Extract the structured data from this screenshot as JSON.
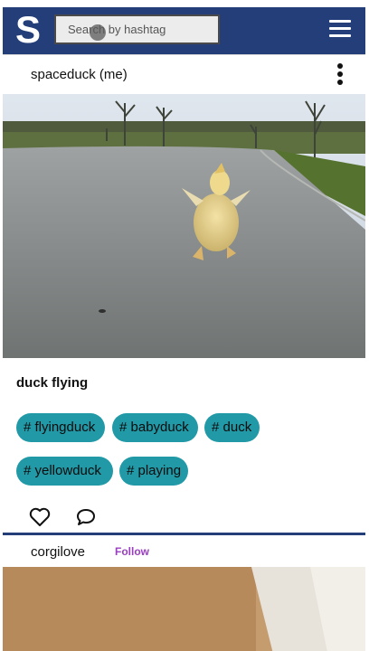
{
  "app": {
    "logo": "S",
    "search_placeholder": "Search by hashtag",
    "brand_color": "#233e78"
  },
  "post": {
    "username": "spaceduck (me)",
    "image_subject": "duck running on a wet road",
    "caption": "duck flying",
    "tags": [
      "# flyingduck",
      "# babyduck",
      "# duck",
      "# yellowduck",
      "# playing"
    ],
    "tag_color": "#2199a7",
    "actions": [
      "heart-icon",
      "comment-icon"
    ]
  },
  "next_post": {
    "username": "corgilove",
    "follow_label": "Follow",
    "follow_color": "#9a3fc2"
  },
  "icons": {
    "menu": "hamburger-menu-icon",
    "options": "kebab-menu-icon"
  }
}
